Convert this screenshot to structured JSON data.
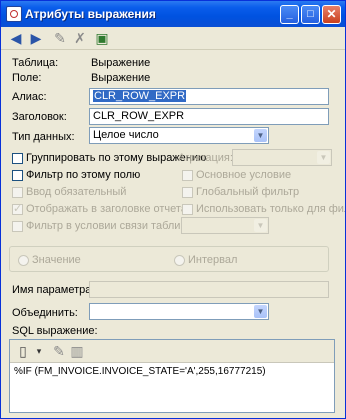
{
  "window": {
    "title": "Атрибуты выражения"
  },
  "fields": {
    "table_label": "Таблица:",
    "table_value": "Выражение",
    "field_label": "Поле:",
    "field_value": "Выражение",
    "alias_label": "Алиас:",
    "alias_value": "CLR_ROW_EXPR",
    "header_label": "Заголовок:",
    "header_value": "CLR_ROW_EXPR",
    "datatype_label": "Тип данных:",
    "datatype_value": "Целое число"
  },
  "options": {
    "group_by": "Группировать по этому выражению",
    "aggregation_label": "Агрегация:",
    "filter_by": "Фильтр по этому полю",
    "main_condition": "Основное условие",
    "input_required": "Ввод обязательный",
    "global_filter": "Глобальный фильтр",
    "show_in_header": "Отображать в заголовке отчета",
    "use_only_for_filter": "Использовать только для фильтра",
    "filter_in_join": "Фильтр в условии связи таблицы"
  },
  "radios": {
    "value": "Значение",
    "interval": "Интервал"
  },
  "param": {
    "name_label": "Имя параметра:",
    "combine_label": "Объединить:"
  },
  "sql": {
    "label": "SQL выражение:",
    "text": "%IF (FM_INVOICE.INVOICE_STATE='A',255,16777215)"
  }
}
